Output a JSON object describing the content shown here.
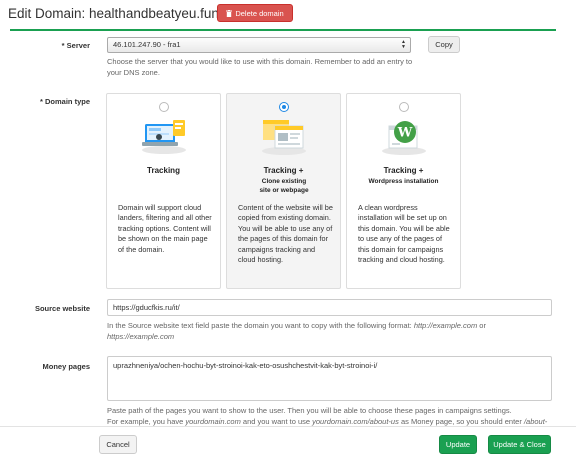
{
  "header": {
    "title": "Edit Domain: healthandbeatyeu.fun",
    "delete_label": "Delete domain"
  },
  "server": {
    "label": "* Server",
    "value": "46.101.247.90 - fra1",
    "copy_label": "Copy",
    "help": "Choose the server that you would like to use with this domain. Remember to add an entry to your DNS zone."
  },
  "domain_type": {
    "label": "* Domain type",
    "selected": "clone",
    "options": [
      {
        "id": "tracking",
        "title": "Tracking",
        "subtitle": "",
        "description": "Domain will support cloud landers, filtering and all other tracking options. Content will be shown on the main page of the domain.",
        "icon": "monitor-tracking-icon"
      },
      {
        "id": "clone",
        "title": "Tracking +",
        "subtitle": "Clone existing site or webpage",
        "description": "Content of the website will be copied from existing domain. You will be able to use any of the pages of this domain for campaigns tracking and cloud hosting.",
        "icon": "clone-pages-icon"
      },
      {
        "id": "wordpress",
        "title": "Tracking +",
        "subtitle": "Wordpress installation",
        "description": "A clean wordpress installation will be set up on this domain. You will be able to use any of the pages of this domain for campaigns tracking and cloud hosting.",
        "icon": "wordpress-icon"
      }
    ]
  },
  "source_website": {
    "label": "Source website",
    "value": "https://gducfkis.ru/it/",
    "help_prefix": "In the Source website text field paste the domain you want to copy with the following format: ",
    "help_example1": "http://example.com",
    "help_or": " or",
    "help_example2": "https://example.com"
  },
  "money_pages": {
    "label": "Money pages",
    "value": "uprazhneniya/ochen-hochu-byt-stroinoi-kak-eto-osushchestvit-kak-byt-stroinoi-i/",
    "help_line1": "Paste path of the pages you want to show to the user. Then you will be able to choose these pages in campaigns settings.",
    "help_line2_prefix": "For example, you have ",
    "help_line2_em1": "yourdomain.com",
    "help_line2_mid": " and you want to use ",
    "help_line2_em2": "yourdomain.com/about-us",
    "help_line2_suffix": " as Money page, so you should enter ",
    "help_line2_em3": "/about-"
  },
  "footer": {
    "cancel_label": "Cancel",
    "update_label": "Update",
    "update_close_label": "Update & Close"
  },
  "colors": {
    "accent_green": "#1aa051",
    "danger_red": "#d9534f",
    "radio_blue": "#1e88e5"
  }
}
